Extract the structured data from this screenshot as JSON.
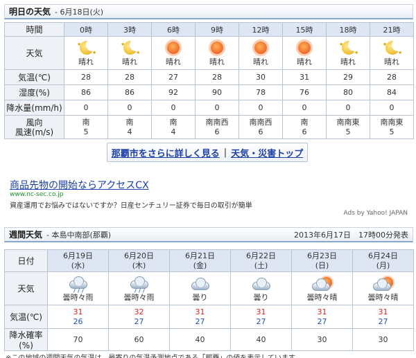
{
  "tomorrow": {
    "title": "明日の天気",
    "date": "- 6月18日(火)",
    "row_labels": {
      "time": "時間",
      "weather": "天気",
      "temp": "気温(℃)",
      "humidity": "湿度(%)",
      "precip": "降水量(mm/h)",
      "wind_dir": "風向",
      "wind_speed": "風速(m/s)"
    },
    "hours": [
      {
        "time": "0時",
        "icon": "moon-icon",
        "weather": "晴れ",
        "temp": "28",
        "humidity": "86",
        "precip": "0",
        "wind_dir": "南",
        "wind_speed": "5"
      },
      {
        "time": "3時",
        "icon": "moon-icon",
        "weather": "晴れ",
        "temp": "28",
        "humidity": "86",
        "precip": "0",
        "wind_dir": "南",
        "wind_speed": "4"
      },
      {
        "time": "6時",
        "icon": "sun-icon",
        "weather": "晴れ",
        "temp": "27",
        "humidity": "92",
        "precip": "0",
        "wind_dir": "南",
        "wind_speed": "4"
      },
      {
        "time": "9時",
        "icon": "sun-icon",
        "weather": "晴れ",
        "temp": "28",
        "humidity": "90",
        "precip": "0",
        "wind_dir": "南南西",
        "wind_speed": "6"
      },
      {
        "time": "12時",
        "icon": "sun-icon",
        "weather": "晴れ",
        "temp": "30",
        "humidity": "78",
        "precip": "0",
        "wind_dir": "南南西",
        "wind_speed": "6"
      },
      {
        "time": "15時",
        "icon": "sun-icon",
        "weather": "晴れ",
        "temp": "31",
        "humidity": "76",
        "precip": "0",
        "wind_dir": "南",
        "wind_speed": "6"
      },
      {
        "time": "18時",
        "icon": "moon-icon",
        "weather": "晴れ",
        "temp": "29",
        "humidity": "80",
        "precip": "0",
        "wind_dir": "南南東",
        "wind_speed": "5"
      },
      {
        "time": "21時",
        "icon": "moon-icon",
        "weather": "晴れ",
        "temp": "28",
        "humidity": "84",
        "precip": "0",
        "wind_dir": "南南東",
        "wind_speed": "5"
      }
    ]
  },
  "links": {
    "city_detail": "那覇市をさらに詳しく見る",
    "separator": "|",
    "weather_top": "天気・災害トップ"
  },
  "ad": {
    "title": "商品先物の開始ならアクセスCX",
    "url": "www.nc-sec.co.jp",
    "description": "資産運用でお悩みではないですか？日産センチュリー証券で毎日の取引が簡単",
    "credit": "Ads by Yahoo! JAPAN"
  },
  "weekly": {
    "title": "週間天気",
    "region": "- 本島中南部(那覇)",
    "issued": "2013年6月17日　17時00分発表",
    "row_labels": {
      "date": "日付",
      "weather": "天気",
      "temp": "気温(℃)",
      "precip_prob": "降水確率(%)"
    },
    "days": [
      {
        "date": "6月19日",
        "dow": "(水)",
        "icon": "cloud-rain-icon",
        "weather": "曇時々雨",
        "high": "31",
        "low": "26",
        "pop": "70"
      },
      {
        "date": "6月20日",
        "dow": "(木)",
        "icon": "cloud-rain-icon",
        "weather": "曇時々雨",
        "high": "32",
        "low": "27",
        "pop": "60"
      },
      {
        "date": "6月21日",
        "dow": "(金)",
        "icon": "cloud-icon",
        "weather": "曇り",
        "high": "31",
        "low": "27",
        "pop": "40"
      },
      {
        "date": "6月22日",
        "dow": "(土)",
        "icon": "cloud-icon",
        "weather": "曇り",
        "high": "31",
        "low": "27",
        "pop": "40"
      },
      {
        "date": "6月23日",
        "dow": "(日)",
        "icon": "cloud-sun-icon",
        "weather": "曇時々晴",
        "high": "31",
        "low": "27",
        "pop": "30"
      },
      {
        "date": "6月24日",
        "dow": "(月)",
        "icon": "cloud-sun-icon",
        "weather": "曇時々晴",
        "high": "31",
        "low": "27",
        "pop": "30"
      }
    ]
  },
  "footnote": "※この地域の週間天気の気温は，最寄りの気温予測地点である「那覇」の値を表示しています。"
}
